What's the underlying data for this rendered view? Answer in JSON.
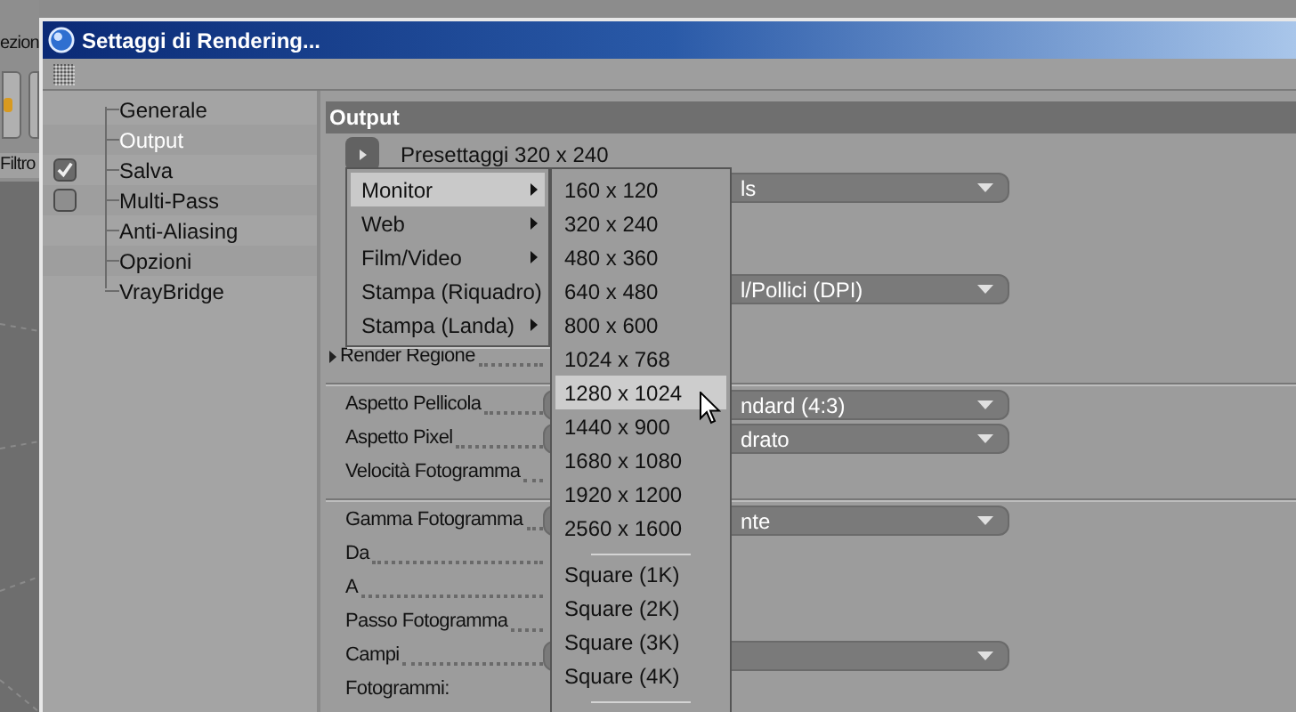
{
  "background_app": {
    "tab_fragment": "ezion",
    "filter_fragment": "Filtro"
  },
  "window": {
    "title": "Settaggi di Rendering..."
  },
  "sidebar": {
    "items": [
      {
        "label": "Generale",
        "selected": false,
        "kind": "plain"
      },
      {
        "label": "Output",
        "selected": true,
        "kind": "plain"
      },
      {
        "label": "Salva",
        "selected": false,
        "kind": "toggle",
        "checked": true
      },
      {
        "label": "Multi-Pass",
        "selected": false,
        "kind": "toggle",
        "checked": false
      },
      {
        "label": "Anti-Aliasing",
        "selected": false,
        "kind": "plain"
      },
      {
        "label": "Opzioni",
        "selected": false,
        "kind": "plain"
      },
      {
        "label": "VrayBridge",
        "selected": false,
        "kind": "plain"
      }
    ]
  },
  "panel": {
    "title": "Output",
    "preset_label": "Presettaggi 320 x 240",
    "rows": [
      {
        "kind": "dropdown",
        "value": "ls"
      },
      {
        "kind": "blank"
      },
      {
        "kind": "blank"
      },
      {
        "kind": "dropdown",
        "value": "l/Pollici (DPI)"
      },
      {
        "kind": "blank"
      },
      {
        "kind": "expander",
        "label": "Render Regione"
      },
      {
        "kind": "separator"
      },
      {
        "kind": "dropdown",
        "label": "Aspetto Pellicola",
        "value": "ndard (4:3)"
      },
      {
        "kind": "dropdown",
        "label": "Aspetto Pixel",
        "value": "drato"
      },
      {
        "kind": "label",
        "label": "Velocità Fotogramma"
      },
      {
        "kind": "separator"
      },
      {
        "kind": "dropdown",
        "label": "Gamma Fotogramma",
        "value": "nte"
      },
      {
        "kind": "label",
        "label": "Da"
      },
      {
        "kind": "label",
        "label": "A"
      },
      {
        "kind": "label",
        "label": "Passo Fotogramma"
      },
      {
        "kind": "dropdown",
        "label": "Campi"
      },
      {
        "kind": "plain",
        "label": "Fotogrammi:"
      }
    ]
  },
  "preset_menu": {
    "items": [
      {
        "label": "Monitor",
        "selected": true
      },
      {
        "label": "Web",
        "selected": false
      },
      {
        "label": "Film/Video",
        "selected": false
      },
      {
        "label": "Stampa (Riquadro)",
        "selected": false
      },
      {
        "label": "Stampa (Landa)",
        "selected": false
      }
    ]
  },
  "submenu": {
    "items": [
      {
        "kind": "item",
        "label": "160 x 120",
        "selected": false
      },
      {
        "kind": "item",
        "label": "320 x 240",
        "selected": false
      },
      {
        "kind": "item",
        "label": "480 x 360",
        "selected": false
      },
      {
        "kind": "item",
        "label": "640 x 480",
        "selected": false
      },
      {
        "kind": "item",
        "label": "800 x 600",
        "selected": false
      },
      {
        "kind": "item",
        "label": "1024 x 768",
        "selected": false
      },
      {
        "kind": "item",
        "label": "1280 x 1024",
        "selected": true
      },
      {
        "kind": "item",
        "label": "1440 x 900",
        "selected": false
      },
      {
        "kind": "item",
        "label": "1680 x 1080",
        "selected": false
      },
      {
        "kind": "item",
        "label": "1920 x 1200",
        "selected": false
      },
      {
        "kind": "item",
        "label": "2560 x 1600",
        "selected": false
      },
      {
        "kind": "separator"
      },
      {
        "kind": "item",
        "label": "Square (1K)",
        "selected": false
      },
      {
        "kind": "item",
        "label": "Square (2K)",
        "selected": false
      },
      {
        "kind": "item",
        "label": "Square (3K)",
        "selected": false
      },
      {
        "kind": "item",
        "label": "Square (4K)",
        "selected": false
      },
      {
        "kind": "separator"
      }
    ]
  }
}
